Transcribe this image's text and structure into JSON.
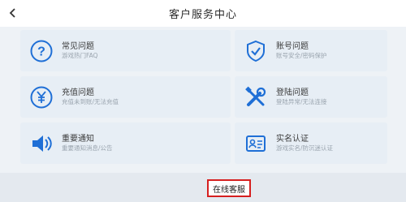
{
  "header": {
    "title": "客户服务中心",
    "back_icon": "back-arrow-icon"
  },
  "cards": [
    {
      "title": "常见问题",
      "subtitle": "游戏热门FAQ",
      "icon": "question-icon"
    },
    {
      "title": "账号问题",
      "subtitle": "账号安全/密码保护",
      "icon": "shield-check-icon"
    },
    {
      "title": "充值问题",
      "subtitle": "充值未到账/无法充值",
      "icon": "yen-icon"
    },
    {
      "title": "登陆问题",
      "subtitle": "登陆异常/无法连接",
      "icon": "tools-icon"
    },
    {
      "title": "重要通知",
      "subtitle": "重要通知消息/公告",
      "icon": "speaker-icon"
    },
    {
      "title": "实名认证",
      "subtitle": "游戏实名/防沉迷认证",
      "icon": "id-card-icon"
    }
  ],
  "footer": {
    "online_service_label": "在线客服"
  },
  "colors": {
    "accent_blue": "#1f6fd6",
    "highlight_red": "#d61f1f",
    "card_bg": "#e7eef5"
  }
}
